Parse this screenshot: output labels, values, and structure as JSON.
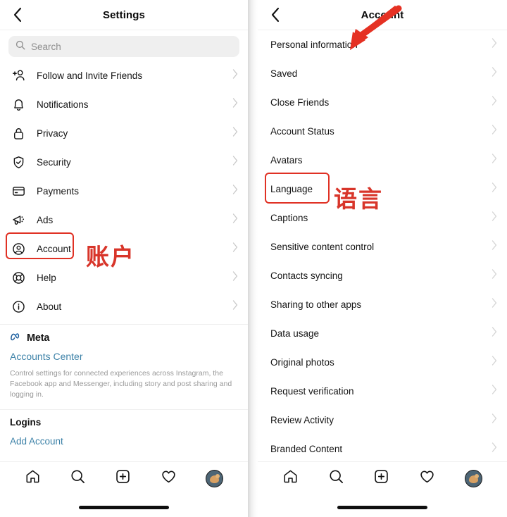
{
  "left_panel": {
    "header": {
      "title": "Settings",
      "back_icon": "chevron-left-icon"
    },
    "search": {
      "placeholder": "Search",
      "icon": "search-icon"
    },
    "items": [
      {
        "label": "Follow and Invite Friends",
        "icon": "person-plus-icon"
      },
      {
        "label": "Notifications",
        "icon": "bell-icon"
      },
      {
        "label": "Privacy",
        "icon": "lock-icon"
      },
      {
        "label": "Security",
        "icon": "shield-check-icon"
      },
      {
        "label": "Payments",
        "icon": "credit-card-icon"
      },
      {
        "label": "Ads",
        "icon": "megaphone-icon"
      },
      {
        "label": "Account",
        "icon": "user-circle-icon"
      },
      {
        "label": "Help",
        "icon": "life-ring-icon"
      },
      {
        "label": "About",
        "icon": "info-circle-icon"
      }
    ],
    "meta": {
      "logo_icon": "meta-infinity-icon",
      "brand": "Meta",
      "accounts_center_link": "Accounts Center",
      "description": "Control settings for connected experiences across Instagram, the Facebook app and Messenger, including story and post sharing and logging in.",
      "logins_heading": "Logins",
      "add_account_link": "Add Account"
    }
  },
  "right_panel": {
    "header": {
      "title": "Account",
      "back_icon": "chevron-left-icon"
    },
    "items": [
      {
        "label": "Personal information"
      },
      {
        "label": "Saved"
      },
      {
        "label": "Close Friends"
      },
      {
        "label": "Account Status"
      },
      {
        "label": "Avatars"
      },
      {
        "label": "Language"
      },
      {
        "label": "Captions"
      },
      {
        "label": "Sensitive content control"
      },
      {
        "label": "Contacts syncing"
      },
      {
        "label": "Sharing to other apps"
      },
      {
        "label": "Data usage"
      },
      {
        "label": "Original photos"
      },
      {
        "label": "Request verification"
      },
      {
        "label": "Review Activity"
      },
      {
        "label": "Branded Content"
      }
    ]
  },
  "tabbar": {
    "items": [
      {
        "name": "home-icon",
        "label": "Home"
      },
      {
        "name": "search-icon",
        "label": "Search"
      },
      {
        "name": "add-post-icon",
        "label": "Create"
      },
      {
        "name": "heart-icon",
        "label": "Activity"
      },
      {
        "name": "profile-avatar",
        "label": "Profile"
      }
    ]
  },
  "annotations": {
    "account_label_cn": "账户",
    "language_label_cn": "语言",
    "highlight_color": "#e03124",
    "highlighted_items": [
      "Account",
      "Language"
    ],
    "arrow": {
      "points_to": "Language",
      "color": "#e53123"
    }
  }
}
